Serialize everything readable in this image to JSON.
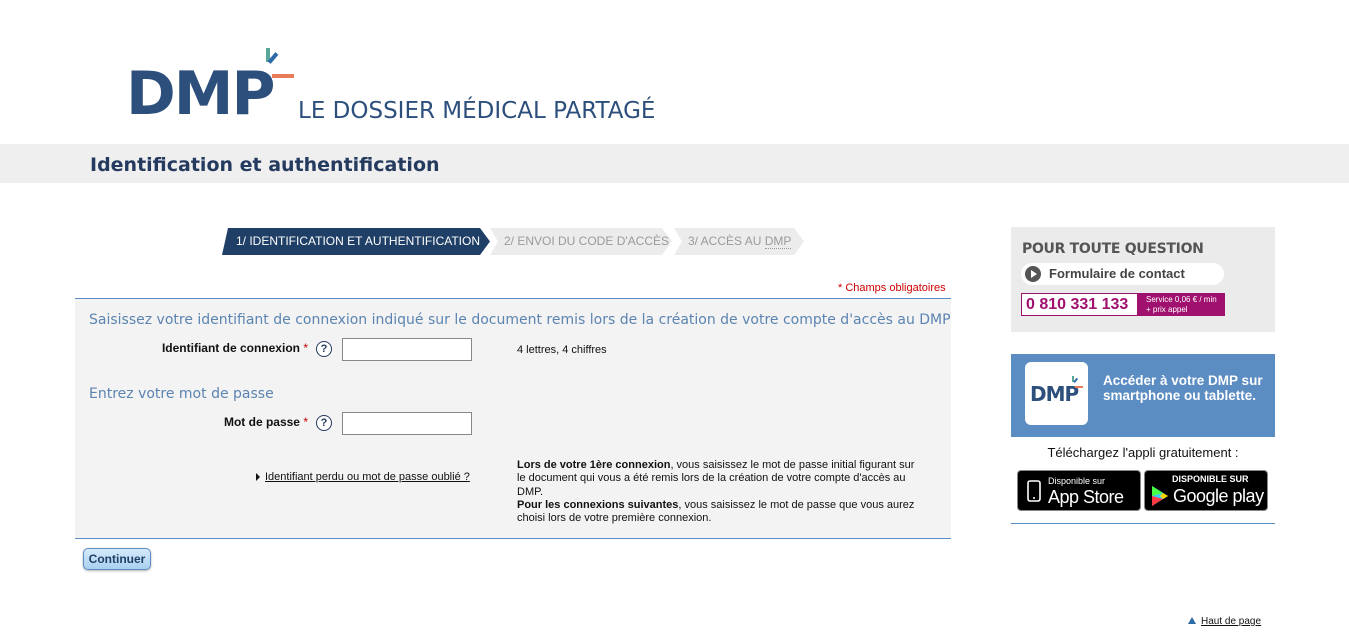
{
  "header": {
    "logo_text": "DMP",
    "logo_subtitle": "LE DOSSIER MÉDICAL PARTAGÉ",
    "page_title": "Identification et authentification"
  },
  "steps": [
    {
      "label": "1/ IDENTIFICATION ET AUTHENTIFICATION",
      "active": true
    },
    {
      "label": "2/ ENVOI DU CODE D'ACCÈS",
      "active": false
    },
    {
      "label_prefix": "3/ ACCÈS AU ",
      "label_abbr": "DMP",
      "active": false
    }
  ],
  "form": {
    "required_note": "* Champs obligatoires",
    "login_section_title": "Saisissez votre identifiant de connexion indiqué sur le document remis lors de la création de votre compte d'accès au DMP",
    "login_label": "Identifiant de connexion",
    "login_hint": "4 lettres, 4 chiffres",
    "login_value": "",
    "password_section_title": "Entrez votre mot de passe",
    "password_label": "Mot de passe",
    "password_value": "",
    "required_star": "*",
    "help_glyph": "?",
    "lost_link": "Identifiant perdu ou mot de passe oublié ?",
    "info_first_bold": "Lors de votre 1ère connexion",
    "info_first_text": ", vous saisissez le mot de passe initial figurant sur le document qui vous a été remis lors de la création de votre compte d'accès au DMP.",
    "info_next_bold": "Pour les connexions suivantes",
    "info_next_text": ", vous saisissez le mot de passe que vous aurez choisi lors de votre première connexion.",
    "continue_label": "Continuer"
  },
  "sidebar": {
    "question_title": "POUR TOUTE QUESTION",
    "contact_label": "Formulaire de contact",
    "phone": "0 810 331 133",
    "phone_rate_line1": "Service 0,06 € / min",
    "phone_rate_line2": "+ prix appel",
    "app_icon_text": "DMP",
    "app_text": "Accéder à votre DMP sur smartphone ou tablette.",
    "download_text": "Téléchargez l'appli gratuitement :",
    "apple_small": "Disponible sur",
    "apple_big": "App Store",
    "google_small": "DISPONIBLE SUR",
    "google_big": "Google play"
  },
  "footer": {
    "top_link": "Haut de page"
  },
  "colors": {
    "brand_blue": "#2c4f7c",
    "step_active": "#1f3f66",
    "accent_blue": "#5b8cc2",
    "phone_magenta": "#a0106f",
    "required_red": "#cc0000"
  }
}
